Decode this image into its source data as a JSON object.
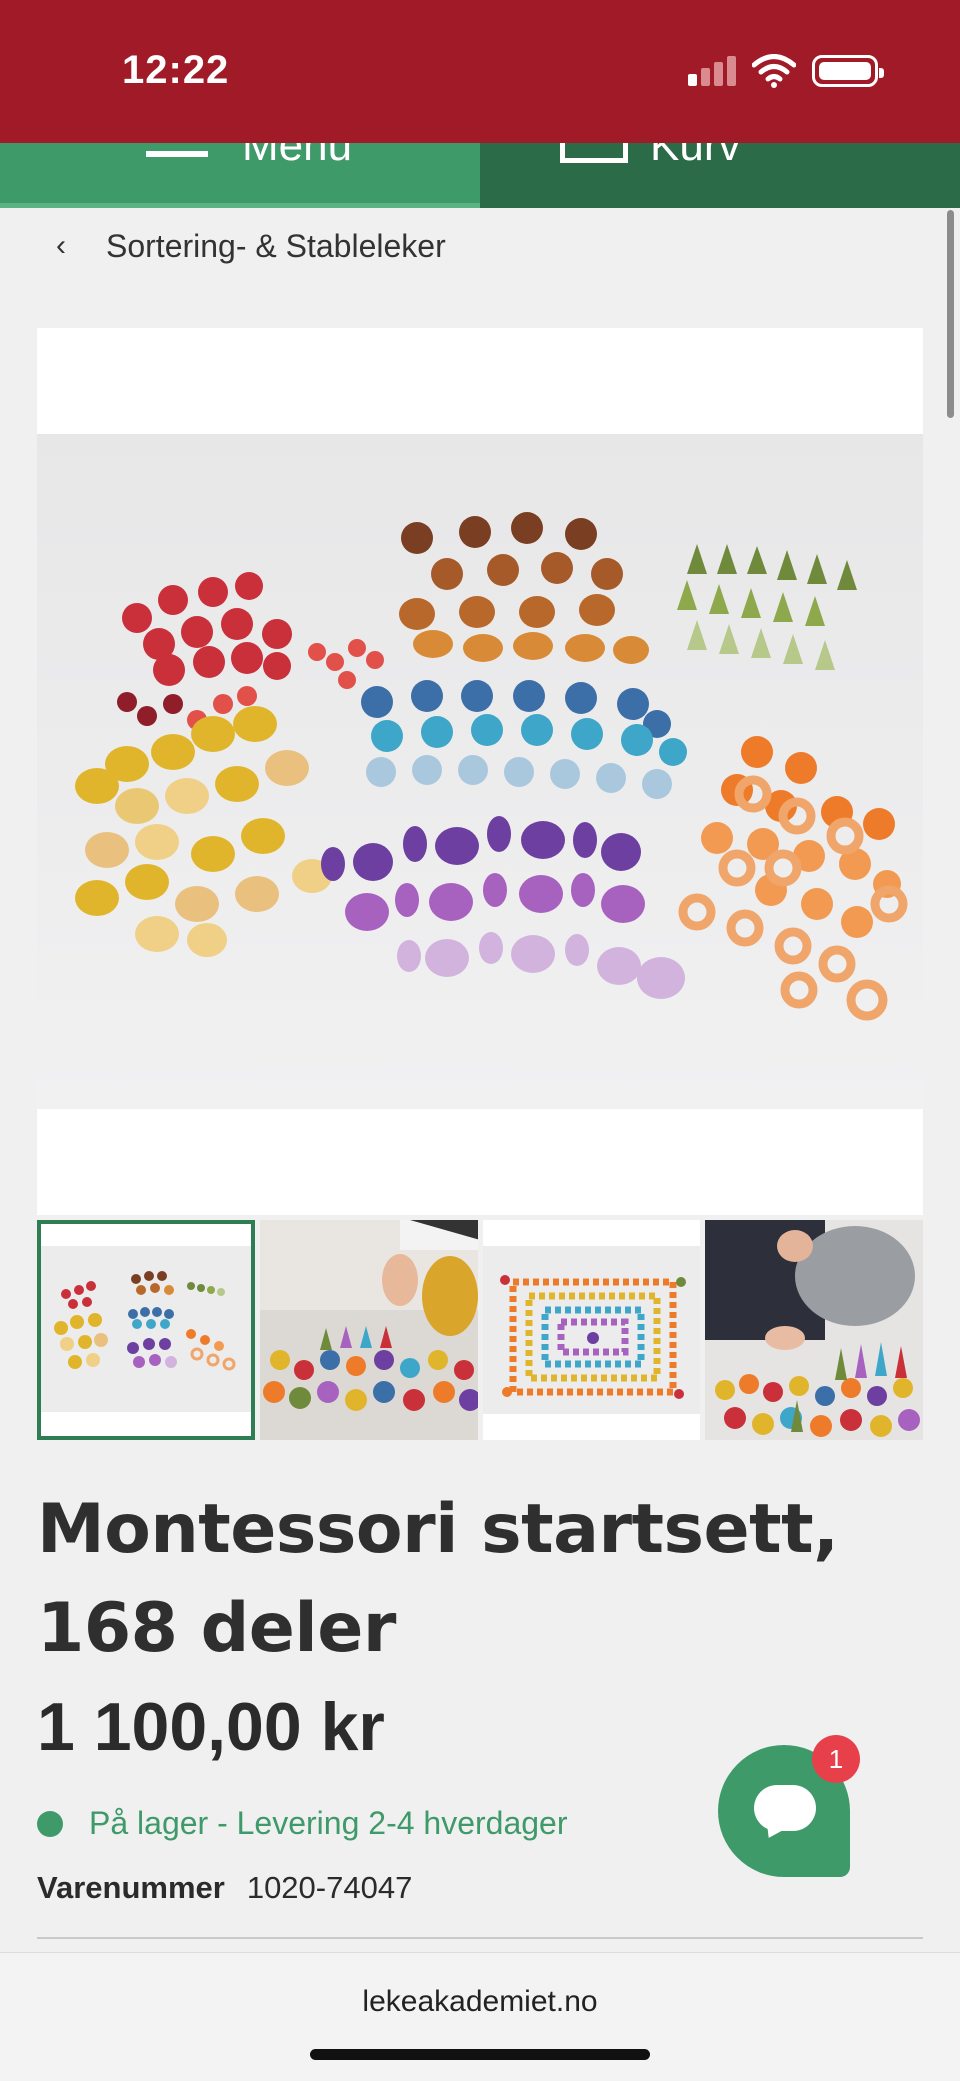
{
  "status_bar": {
    "time": "12:22",
    "signal_bars_active": 1,
    "signal_bars_total": 4
  },
  "nav": {
    "menu_label": "Menu",
    "cart_label": "Kurv"
  },
  "breadcrumb": {
    "back_icon": "chevron-left-icon",
    "label": "Sortering- & Stableleker"
  },
  "product": {
    "title": "Montessori startsett, 168 deler",
    "price": "1 100,00 kr",
    "stock_text": "På lager - Levering 2-4 hverdager",
    "sku_label": "Varenummer",
    "sku_value": "1020-74047",
    "thumbnail_count": 4,
    "active_thumbnail": 1
  },
  "chat": {
    "badge_count": "1",
    "icon": "chat-bubble-icon"
  },
  "browser": {
    "url": "lekeakademiet.no"
  },
  "colors": {
    "status_bar": "#a01b27",
    "nav_menu": "#3f9a6a",
    "nav_cart": "#2b6b47",
    "accent_green": "#3f9a6a",
    "badge_red": "#e7404a"
  }
}
